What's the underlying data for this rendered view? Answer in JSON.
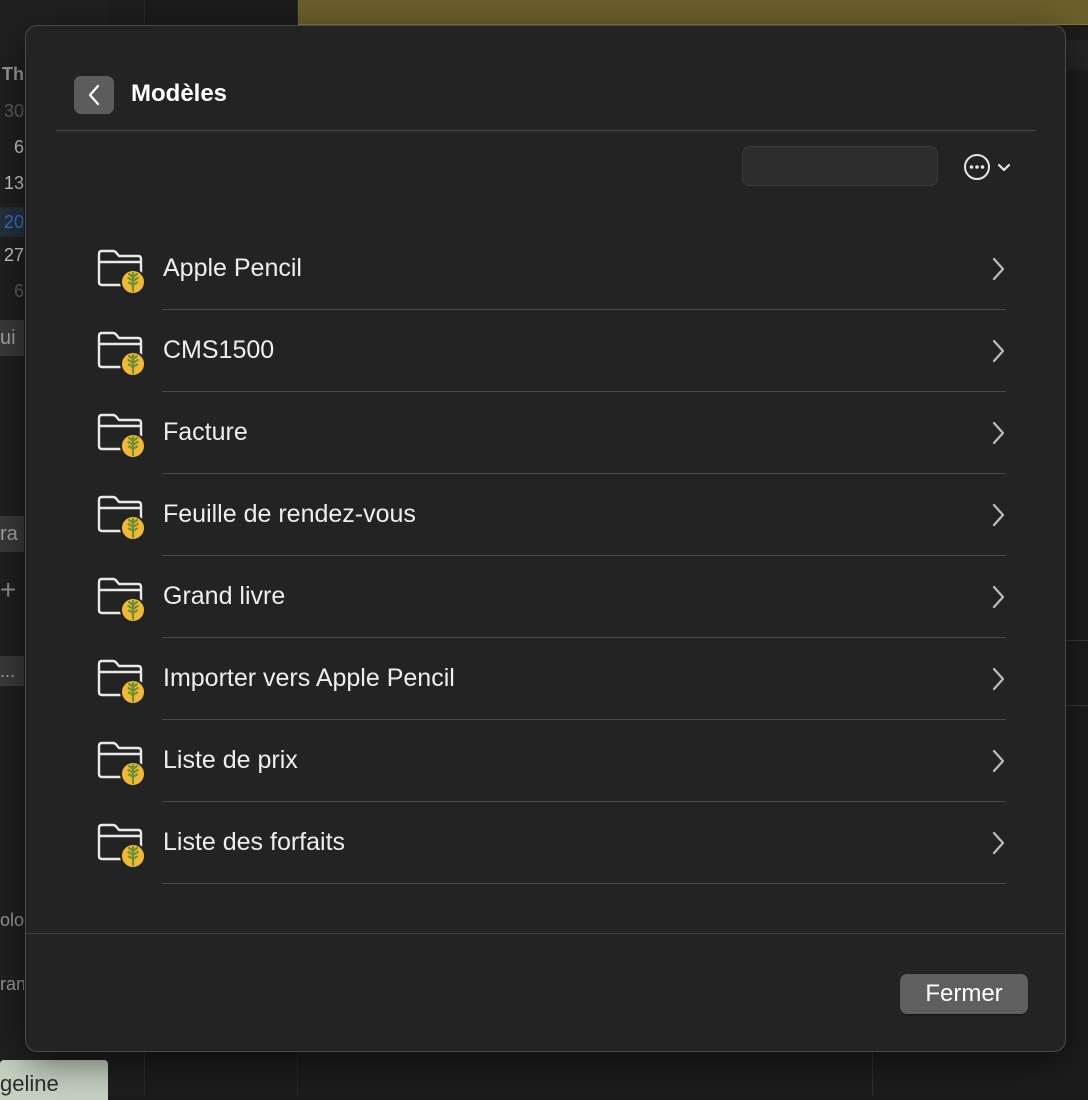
{
  "background": {
    "calendar": {
      "header": "Th",
      "days": [
        "30",
        "6",
        "13",
        "20",
        "27",
        "6"
      ]
    },
    "chips": [
      "ui",
      "ra",
      "..."
    ],
    "texts": [
      "olo",
      "ran"
    ],
    "bottom_tag": "geline"
  },
  "sheet": {
    "title": "Modèles",
    "search": {
      "value": "",
      "placeholder": ""
    },
    "items": [
      {
        "label": "Apple Pencil"
      },
      {
        "label": "CMS1500"
      },
      {
        "label": "Facture"
      },
      {
        "label": "Feuille de rendez-vous"
      },
      {
        "label": "Grand livre"
      },
      {
        "label": "Importer vers Apple Pencil"
      },
      {
        "label": "Liste de prix"
      },
      {
        "label": "Liste des forfaits"
      }
    ],
    "close_label": "Fermer"
  },
  "colors": {
    "sheet_bg": "#232323",
    "badge": "#f0b83a",
    "leaf": "#6f8e2e",
    "banner": "#6c602c",
    "today": "#3a73c6"
  },
  "icons": {
    "back": "chevron-left-icon",
    "more": "ellipsis-circle-icon",
    "more_caret": "chevron-down-icon",
    "folder": "folder-with-badge-icon",
    "row_chevron": "chevron-right-icon"
  }
}
